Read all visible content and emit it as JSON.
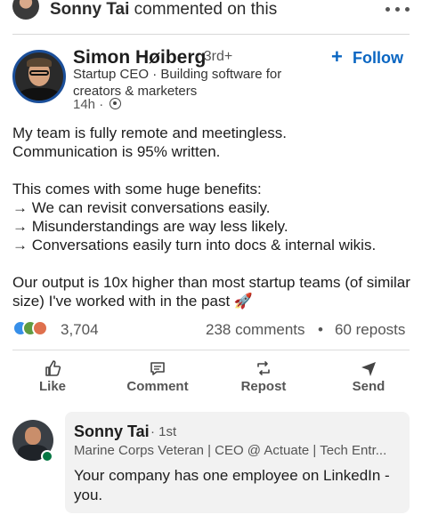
{
  "activity": {
    "actor": "Sonny Tai",
    "action": "commented on this"
  },
  "post": {
    "author": {
      "name": "Simon Høiberg",
      "degree": "· 3rd+",
      "headline": "Startup CEO · Building software for creators & marketers",
      "time": "14h ·"
    },
    "follow_label": "Follow",
    "follow_icon": "+",
    "body": {
      "line1": "My team is fully remote and meetingless.",
      "line2": "Communication is 95% written.",
      "line3": "This comes with some huge benefits:",
      "line4": "→ We can revisit conversations easily.",
      "line5": "→ Misunderstandings are way less likely.",
      "line6": "→ Conversations easily turn into docs & internal wikis.",
      "line7": "Our output is 10x higher than most startup teams (of similar size) I've worked with in the past 🚀"
    },
    "social": {
      "reaction_count": "3,704",
      "comments": "238 comments",
      "separator": "•",
      "reposts": "60 reposts"
    },
    "actions": {
      "like": "Like",
      "comment": "Comment",
      "repost": "Repost",
      "send": "Send"
    }
  },
  "comment": {
    "name": "Sonny Tai",
    "degree": "· 1st",
    "headline": "Marine Corps Veteran | CEO @ Actuate | Tech Entr...",
    "text": "Your company has one employee on LinkedIn - you."
  },
  "colors": {
    "accent": "#0a66c2",
    "avatar_ring": "#1b4f9a",
    "online": "#057642"
  }
}
